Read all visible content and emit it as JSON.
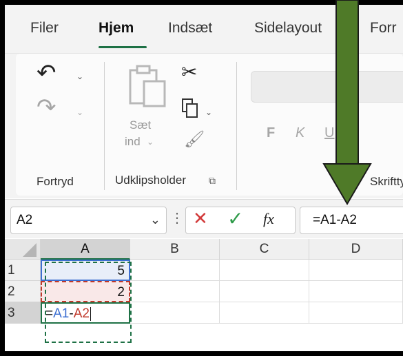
{
  "tabs": [
    {
      "label": "Filer"
    },
    {
      "label": "Hjem"
    },
    {
      "label": "Indsæt"
    },
    {
      "label": "Sidelayout"
    },
    {
      "label": "Forr"
    }
  ],
  "ribbon": {
    "undo_group_label": "Fortryd",
    "clipboard": {
      "paste_label_line1": "Sæt",
      "paste_label_line2": "ind",
      "group_label": "Udklipsholder"
    },
    "font": {
      "bold_glyph": "F",
      "italic_glyph": "K",
      "underline_glyph": "U",
      "group_label_partial": "Skriftty"
    }
  },
  "formula_bar": {
    "name_box": "A2",
    "cancel_glyph": "✕",
    "enter_glyph": "✓",
    "fx_label": "fx",
    "content": "=A1-A2"
  },
  "grid": {
    "columns": [
      "A",
      "B",
      "C",
      "D"
    ],
    "rows": [
      {
        "num": "1",
        "a": "5"
      },
      {
        "num": "2",
        "a": "2"
      },
      {
        "num": "3",
        "a_parts": [
          "=",
          "A1",
          "-",
          "A2"
        ]
      }
    ]
  },
  "colors": {
    "accent_green": "#1e7145",
    "ref_blue": "#3c6fd1",
    "ref_red": "#c0392b",
    "cell_a1_fill": "#e8eef9",
    "cell_a2_fill": "#f9e8e8",
    "arrow_fill": "#4f7a28"
  }
}
